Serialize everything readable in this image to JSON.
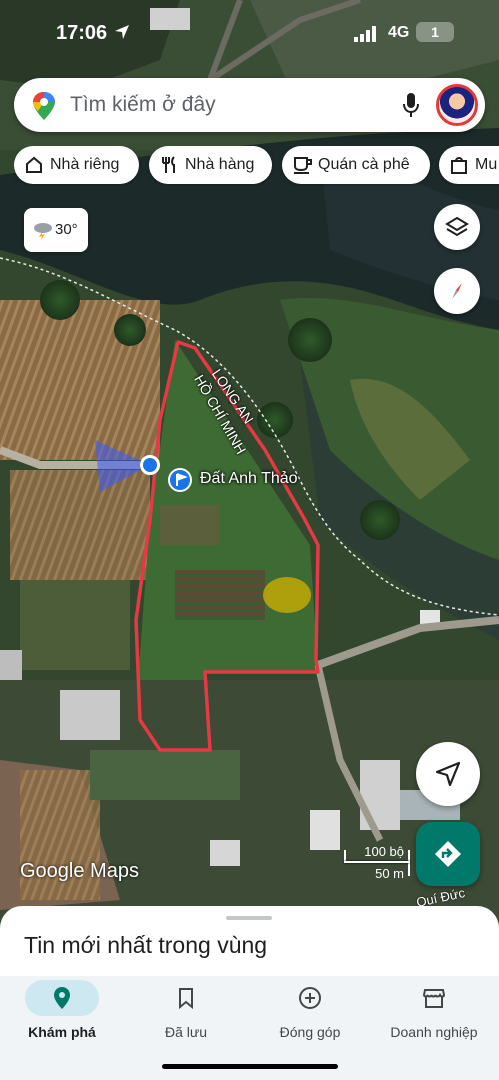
{
  "status_bar": {
    "time": "17:06",
    "network": "4G",
    "battery": "1"
  },
  "search": {
    "placeholder": "Tìm kiếm ở đây"
  },
  "chips": [
    {
      "label": "Nhà riêng",
      "icon": "home-icon"
    },
    {
      "label": "Nhà hàng",
      "icon": "restaurant-icon"
    },
    {
      "label": "Quán cà phê",
      "icon": "coffee-icon"
    },
    {
      "label": "Mu",
      "icon": "shopping-bag-icon"
    }
  ],
  "weather": {
    "temp": "30°",
    "icon": "thunderstorm-icon"
  },
  "map": {
    "labels": {
      "province_1": "LONG AN",
      "province_2": "HỒ CHÍ MINH",
      "place": "Đất Anh Thảo",
      "road": "Quí Đức"
    },
    "attribution": "Google Maps",
    "scale": {
      "imperial": "100 bộ",
      "metric": "50 m"
    },
    "accent_red": "#e53945",
    "accent_blue": "#1a73e8"
  },
  "sheet": {
    "title": "Tin mới nhất trong vùng"
  },
  "tabs": [
    {
      "label": "Khám phá",
      "icon": "explore-pin-icon",
      "active": true
    },
    {
      "label": "Đã lưu",
      "icon": "bookmark-icon",
      "active": false
    },
    {
      "label": "Đóng góp",
      "icon": "add-circle-icon",
      "active": false
    },
    {
      "label": "Doanh nghiệp",
      "icon": "storefront-icon",
      "active": false
    }
  ]
}
